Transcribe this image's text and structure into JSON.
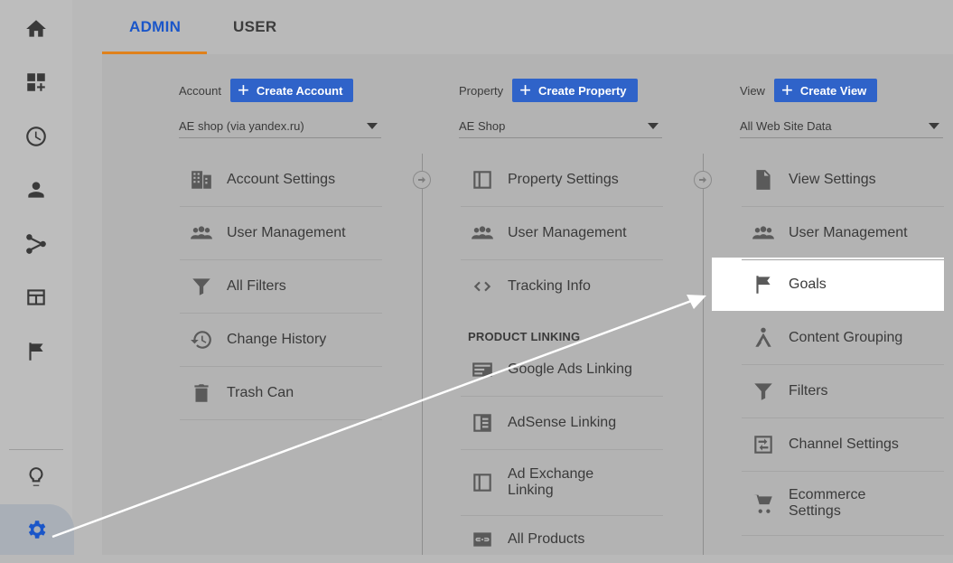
{
  "tabs": [
    {
      "label": "ADMIN",
      "active": true
    },
    {
      "label": "USER",
      "active": false
    }
  ],
  "rail": {
    "icons": [
      "home-icon",
      "customization-icon",
      "realtime-icon",
      "audience-icon",
      "acquisition-icon",
      "behavior-icon",
      "conversions-icon",
      "discover-icon",
      "admin-gear-icon"
    ]
  },
  "account": {
    "label": "Account",
    "create_label": "Create Account",
    "selected": "AE shop (via yandex.ru)",
    "items": [
      {
        "label": "Account Settings",
        "icon": "building-icon"
      },
      {
        "label": "User Management",
        "icon": "people-icon"
      },
      {
        "label": "All Filters",
        "icon": "filter-icon"
      },
      {
        "label": "Change History",
        "icon": "history-icon"
      },
      {
        "label": "Trash Can",
        "icon": "trash-icon"
      }
    ]
  },
  "property": {
    "label": "Property",
    "create_label": "Create Property",
    "selected": "AE Shop",
    "items": [
      {
        "label": "Property Settings",
        "icon": "layout-icon"
      },
      {
        "label": "User Management",
        "icon": "people-icon"
      },
      {
        "label": "Tracking Info",
        "icon": "code-icon"
      }
    ],
    "section_label": "PRODUCT LINKING",
    "linking": [
      {
        "label": "Google Ads Linking",
        "icon": "ads-icon"
      },
      {
        "label": "AdSense Linking",
        "icon": "adsense-icon"
      },
      {
        "label": "Ad Exchange Linking",
        "icon": "adexchange-icon"
      },
      {
        "label": "All Products",
        "icon": "link-icon"
      }
    ]
  },
  "view": {
    "label": "View",
    "create_label": "Create View",
    "selected": "All Web Site Data",
    "items": [
      {
        "label": "View Settings",
        "icon": "document-icon"
      },
      {
        "label": "User Management",
        "icon": "people-icon"
      },
      {
        "label": "Goals",
        "icon": "flag-icon"
      },
      {
        "label": "Content Grouping",
        "icon": "content-grouping-icon"
      },
      {
        "label": "Filters",
        "icon": "filter-icon"
      },
      {
        "label": "Channel Settings",
        "icon": "channel-icon"
      },
      {
        "label": "Ecommerce Settings",
        "icon": "cart-icon"
      }
    ]
  },
  "colors": {
    "accent": "#1a56c9",
    "button": "#2f63c9",
    "tab_underline": "#e0811c",
    "highlight": "#ffffff"
  }
}
